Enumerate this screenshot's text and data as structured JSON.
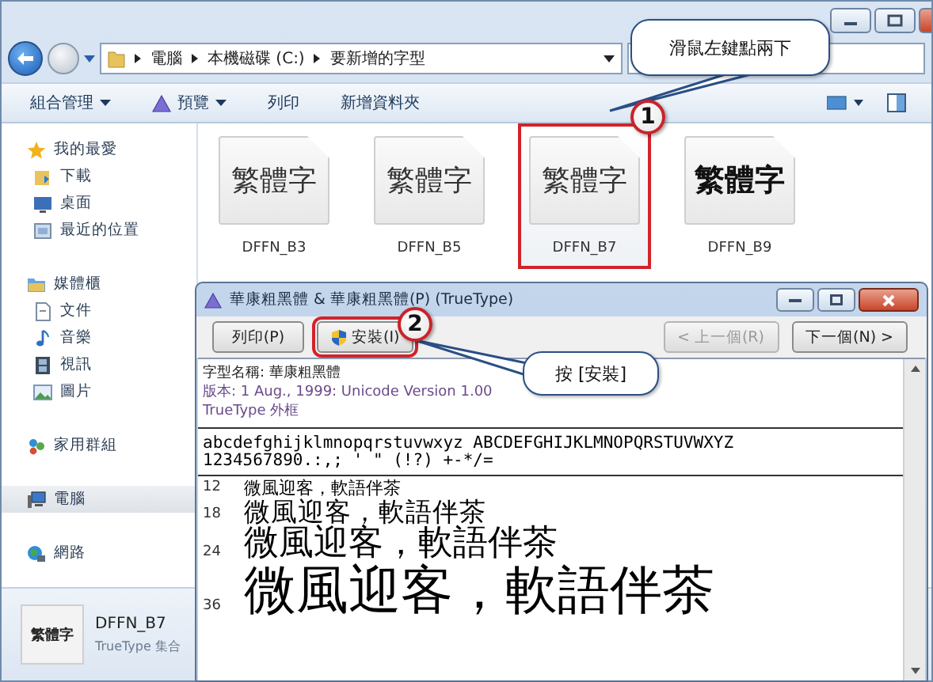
{
  "address": {
    "crumbs": [
      "電腦",
      "本機磁碟 (C:)",
      "要新增的字型"
    ]
  },
  "toolbar": [
    {
      "label": "組合管理",
      "kind": "menu"
    },
    {
      "label": "預覽",
      "kind": "menu"
    },
    {
      "label": "列印",
      "kind": "plain"
    },
    {
      "label": "新增資料夾",
      "kind": "plain"
    }
  ],
  "sidebar": {
    "groups": [
      {
        "label": "我的最愛",
        "selected": false,
        "children": [
          {
            "label": "下載",
            "selected": false
          },
          {
            "label": "桌面",
            "selected": false
          },
          {
            "label": "最近的位置",
            "selected": false
          }
        ]
      },
      {
        "label": "媒體櫃",
        "selected": false,
        "children": [
          {
            "label": "文件",
            "selected": false
          },
          {
            "label": "音樂",
            "selected": false
          },
          {
            "label": "視訊",
            "selected": false
          },
          {
            "label": "圖片",
            "selected": false
          }
        ]
      },
      {
        "label": "家用群組",
        "selected": false
      },
      {
        "label": "電腦",
        "selected": true
      },
      {
        "label": "網路",
        "selected": false
      }
    ]
  },
  "files": [
    {
      "name": "DFFN_B3",
      "thumb": "繁體字",
      "kind": "regular",
      "selected": false
    },
    {
      "name": "DFFN_B5",
      "thumb": "繁體字",
      "kind": "regular",
      "selected": false
    },
    {
      "name": "DFFN_B7",
      "thumb": "繁體字",
      "kind": "regular",
      "selected": true
    },
    {
      "name": "DFFN_B9",
      "thumb": "繁體字",
      "kind": "bold",
      "selected": false
    }
  ],
  "details": {
    "thumb": "繁體字",
    "name": "DFFN_B7",
    "type": "TrueType 集合"
  },
  "font_dialog": {
    "title": "華康粗黑體 & 華康粗黑體(P) (TrueType)",
    "actions_left": [
      {
        "label": "列印(P)",
        "kind": "plain",
        "highlighted": false,
        "disabled": false
      },
      {
        "label": "安裝(I)",
        "kind": "shield",
        "highlighted": true,
        "disabled": false
      }
    ],
    "actions_right": [
      {
        "label": "< 上一個(R)",
        "kind": "plain",
        "highlighted": false,
        "disabled": true
      },
      {
        "label": "下一個(N) >",
        "kind": "plain",
        "highlighted": false,
        "disabled": false
      }
    ],
    "info": [
      {
        "text": "字型名稱: 華康粗黑體",
        "kind": "name"
      },
      {
        "text": "版本: 1 Aug., 1999: Unicode Version 1.00",
        "kind": "version"
      },
      {
        "text": "TrueType 外框",
        "kind": "outline"
      }
    ],
    "charset": [
      "abcdefghijklmnopqrstuvwxyz ABCDEFGHIJKLMNOPQRSTUVWXYZ",
      "1234567890.:,; ' \" (!?) +-*/="
    ],
    "samples": [
      {
        "size": "12",
        "text": "微風迎客，軟語伴茶"
      },
      {
        "size": "18",
        "text": "微風迎客，軟語伴茶"
      },
      {
        "size": "24",
        "text": "微風迎客，軟語伴茶"
      },
      {
        "size": "36",
        "text": "微風迎客，軟語伴茶"
      }
    ]
  },
  "callouts": [
    {
      "number": "1",
      "text": "滑鼠左鍵點兩下"
    },
    {
      "number": "2",
      "text": "按 [安裝]"
    }
  ]
}
